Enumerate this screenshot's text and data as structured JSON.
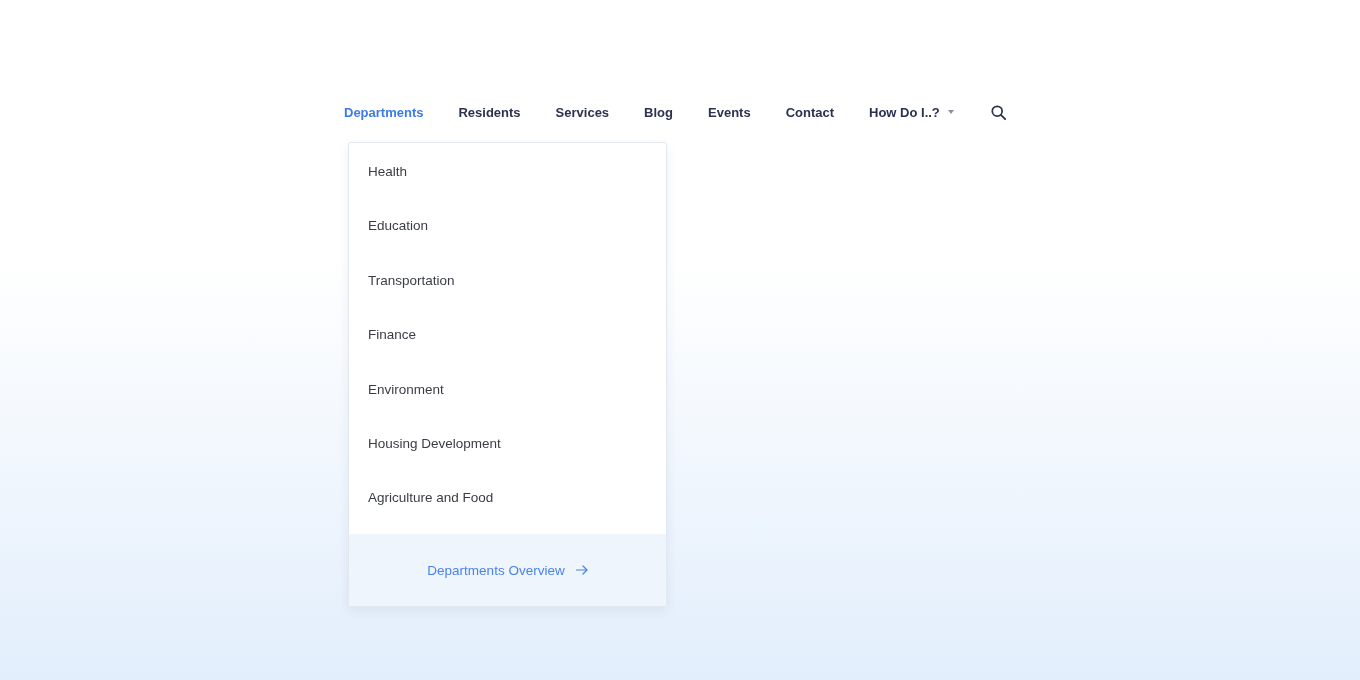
{
  "nav": {
    "items": [
      {
        "label": "Departments",
        "kind": "link",
        "selected": true,
        "menu": {
          "items": [
            "Health",
            "Education",
            "Transportation",
            "Finance",
            "Environment",
            "Housing Development",
            "Agriculture and Food"
          ],
          "footer_link": "Departments Overview"
        }
      },
      {
        "label": "Residents",
        "kind": "link",
        "selected": false
      },
      {
        "label": "Services",
        "kind": "link",
        "selected": false
      },
      {
        "label": "Blog",
        "kind": "link",
        "selected": false
      },
      {
        "label": "Events",
        "kind": "link",
        "selected": false
      },
      {
        "label": "Contact",
        "kind": "link",
        "selected": false
      },
      {
        "label": "How Do I..?",
        "kind": "dropdown",
        "selected": false
      }
    ]
  }
}
